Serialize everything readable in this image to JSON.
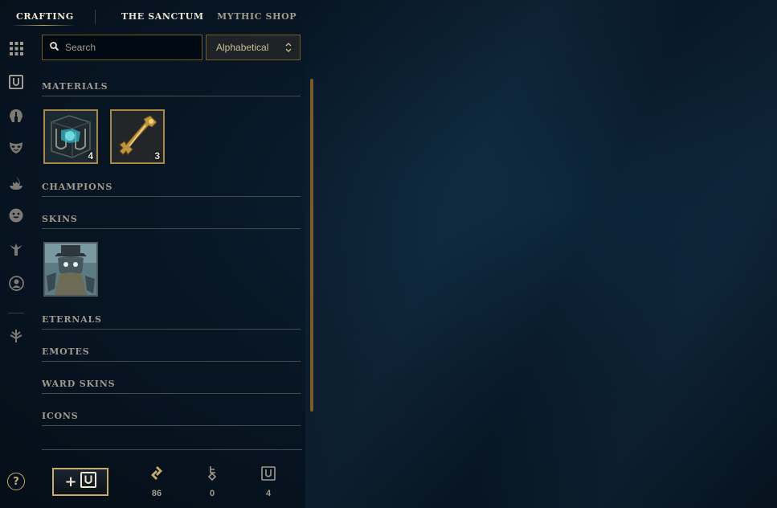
{
  "nav": {
    "tabs": [
      {
        "label": "CRAFTING"
      },
      {
        "label": "THE SANCTUM"
      },
      {
        "label": "MYTHIC SHOP"
      }
    ]
  },
  "rail": {
    "icons": [
      "grid-icon",
      "chest-icon",
      "champion-helmet-icon",
      "mask-icon",
      "flame-icon",
      "emote-face-icon",
      "ward-icon",
      "profile-icon",
      "sword-down-icon"
    ],
    "help_label": "?"
  },
  "search": {
    "placeholder": "Search",
    "value": ""
  },
  "sort": {
    "selected": "Alphabetical"
  },
  "sections": [
    {
      "label": "MATERIALS"
    },
    {
      "label": "CHAMPIONS"
    },
    {
      "label": "SKINS"
    },
    {
      "label": "ETERNALS"
    },
    {
      "label": "EMOTES"
    },
    {
      "label": "WARD SKINS"
    },
    {
      "label": "ICONS"
    }
  ],
  "materials": [
    {
      "name": "hextech-chest",
      "count": "4"
    },
    {
      "name": "hextech-key",
      "count": "3"
    }
  ],
  "skins": [
    {
      "name": "skin-shard"
    }
  ],
  "footer": {
    "add_label": "+",
    "currencies": [
      {
        "icon": "orange-essence-icon",
        "value": "86"
      },
      {
        "icon": "key-fragment-icon",
        "value": "0"
      },
      {
        "icon": "chest-icon",
        "value": "4"
      }
    ]
  },
  "colors": {
    "gold": "#c8aa6e",
    "gold_dark": "#785a28",
    "text": "#a09b8c",
    "text_bright": "#f0e6d2",
    "background": "#081726"
  }
}
